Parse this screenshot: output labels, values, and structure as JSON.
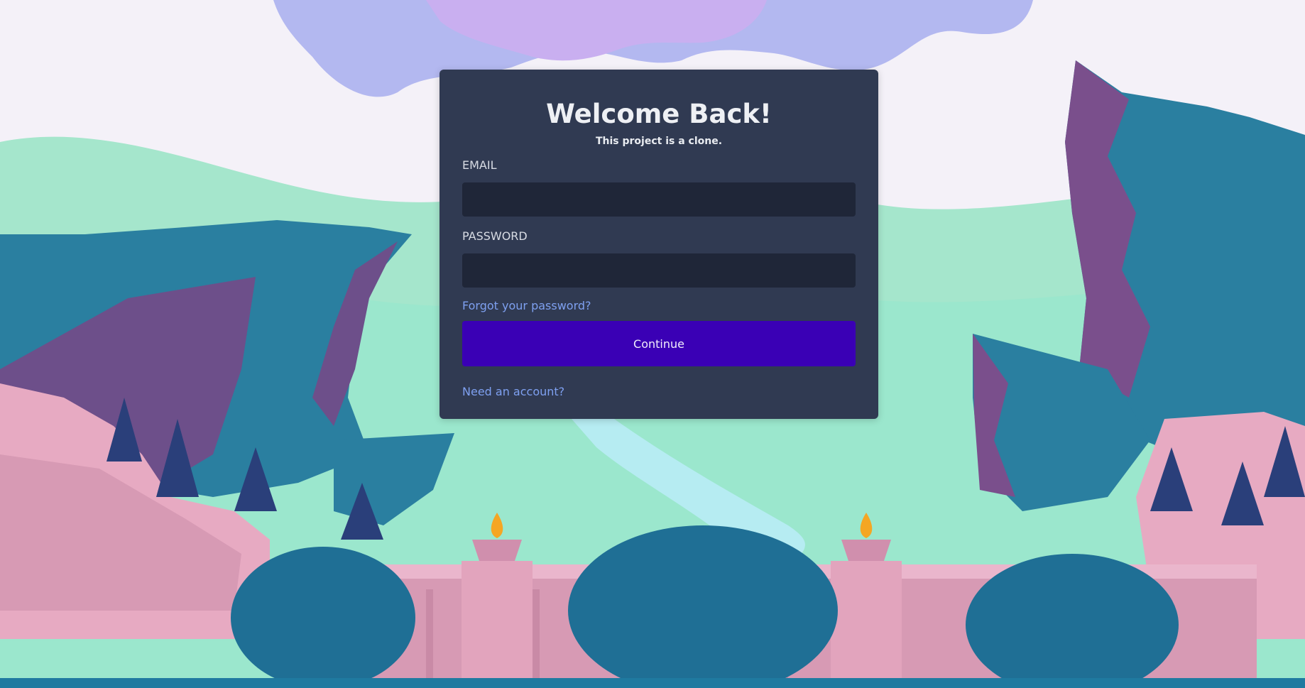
{
  "colors": {
    "card_bg": "#303a52",
    "input_bg": "#1f2638",
    "button_bg": "#3a00b5",
    "link": "#7ea0f0",
    "sky": "#f4f1f8"
  },
  "login": {
    "title": "Welcome Back!",
    "subtitle": "This project is a clone.",
    "email_label": "EMAIL",
    "email_value": "",
    "password_label": "PASSWORD",
    "password_value": "",
    "forgot_link": "Forgot your password?",
    "continue_button": "Continue",
    "register_link": "Need an account?"
  }
}
